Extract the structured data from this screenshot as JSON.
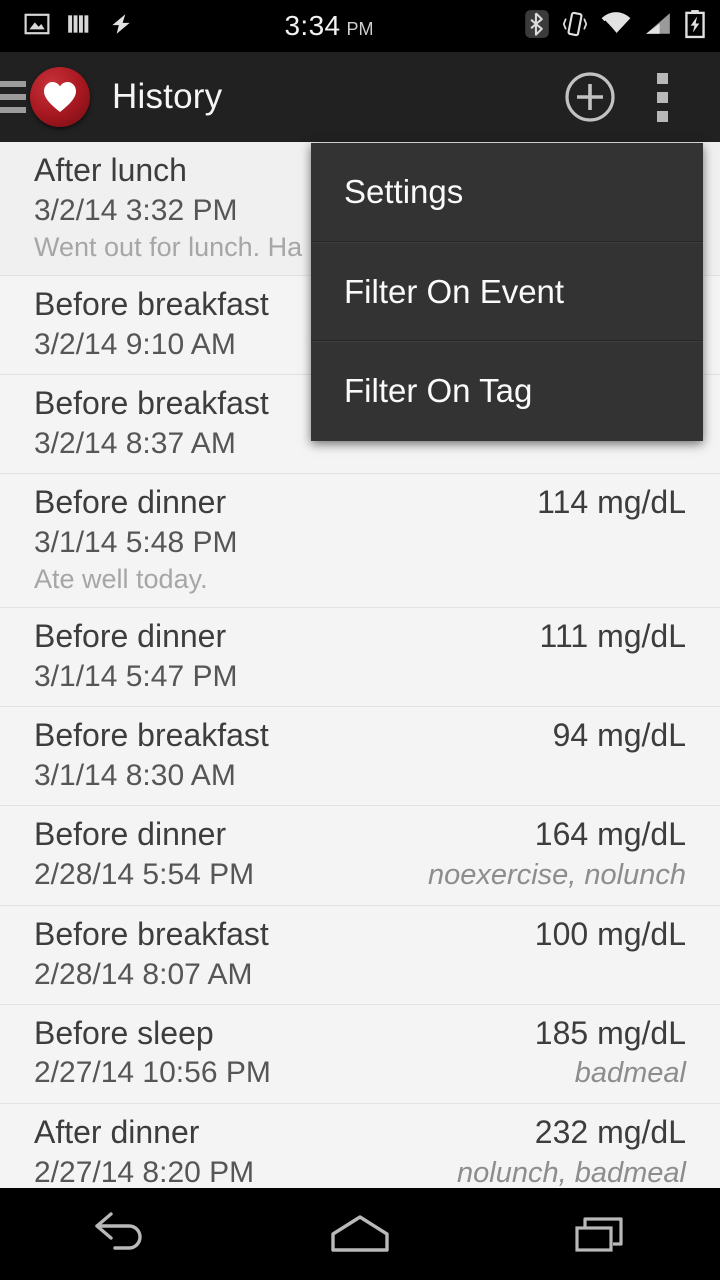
{
  "status_bar": {
    "time": "3:34",
    "ampm": "PM",
    "left_icons": [
      "image-icon",
      "barcode-icon",
      "flash-icon"
    ],
    "right_icons": [
      "bluetooth-icon",
      "vibrate-icon",
      "wifi-icon",
      "cellular-signal-icon",
      "battery-charging-icon"
    ]
  },
  "app_bar": {
    "title": "History",
    "logo_icon": "heart-logo-icon",
    "drawer_icon": "drawer-handle-icon",
    "add_icon": "add-circle-icon",
    "overflow_icon": "overflow-menu-icon",
    "background": "#212121",
    "accent": "#a81820"
  },
  "overflow_menu": {
    "visible": true,
    "background": "#333333",
    "items": [
      {
        "label": "Settings"
      },
      {
        "label": "Filter On Event"
      },
      {
        "label": "Filter On Tag"
      }
    ]
  },
  "history": {
    "unit": "mg/dL",
    "rows": [
      {
        "event": "After lunch",
        "datetime": "3/2/14 3:32 PM",
        "value": "",
        "tags": "",
        "note": "Went out for lunch. Ha"
      },
      {
        "event": "Before breakfast",
        "datetime": "3/2/14 9:10 AM",
        "value": "",
        "tags": "",
        "note": ""
      },
      {
        "event": "Before breakfast",
        "datetime": "3/2/14 8:37 AM",
        "value": "",
        "tags": "",
        "note": ""
      },
      {
        "event": "Before dinner",
        "datetime": "3/1/14 5:48 PM",
        "value": "114 mg/dL",
        "tags": "",
        "note": "Ate well today."
      },
      {
        "event": "Before dinner",
        "datetime": "3/1/14 5:47 PM",
        "value": "111 mg/dL",
        "tags": "",
        "note": ""
      },
      {
        "event": "Before breakfast",
        "datetime": "3/1/14 8:30 AM",
        "value": "94 mg/dL",
        "tags": "",
        "note": ""
      },
      {
        "event": "Before dinner",
        "datetime": "2/28/14 5:54 PM",
        "value": "164 mg/dL",
        "tags": "noexercise, nolunch",
        "note": ""
      },
      {
        "event": "Before breakfast",
        "datetime": "2/28/14 8:07 AM",
        "value": "100 mg/dL",
        "tags": "",
        "note": ""
      },
      {
        "event": "Before sleep",
        "datetime": "2/27/14 10:56 PM",
        "value": "185 mg/dL",
        "tags": "badmeal",
        "note": ""
      },
      {
        "event": "After dinner",
        "datetime": "2/27/14 8:20 PM",
        "value": "232 mg/dL",
        "tags": "nolunch, badmeal",
        "note": ""
      }
    ]
  },
  "nav_bar": {
    "back_icon": "back-arrow-icon",
    "home_icon": "home-icon",
    "recents_icon": "recents-icon"
  }
}
